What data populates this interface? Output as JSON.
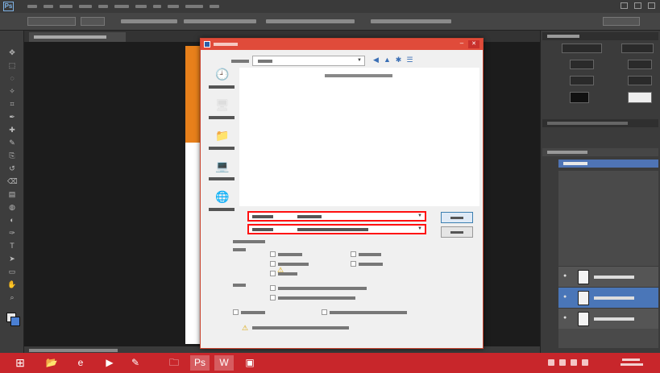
{
  "app": {
    "logo_text": "Ps"
  },
  "toolbar_icons": [
    "move-icon",
    "marquee-icon",
    "lasso-icon",
    "quick-select-icon",
    "crop-icon",
    "eyedropper-icon",
    "healing-brush-icon",
    "brush-icon",
    "clone-stamp-icon",
    "history-brush-icon",
    "eraser-icon",
    "gradient-icon",
    "blur-icon",
    "dodge-icon",
    "pen-icon",
    "type-icon",
    "path-select-icon",
    "shape-icon",
    "hand-icon",
    "zoom-icon"
  ],
  "save_dialog": {
    "highlight_color": "#ff1010",
    "title_bar_color": "#e04b3a",
    "close_glyph": "✕",
    "min_glyph": "–",
    "dropdown_glyph": "▼",
    "places": [
      {
        "icon": "recent-places-icon",
        "glyph": "🕘"
      },
      {
        "icon": "desktop-icon",
        "glyph": "🖥"
      },
      {
        "icon": "libraries-icon",
        "glyph": "📁"
      },
      {
        "icon": "computer-icon",
        "glyph": "💻"
      },
      {
        "icon": "network-icon",
        "glyph": "🌐"
      }
    ],
    "nav_glyphs": [
      "◀",
      "▲",
      "✱",
      "☰"
    ],
    "warning_glyph": "⚠"
  },
  "taskbar": {
    "color": "#c8262b",
    "start_glyph": "⊞",
    "apps": [
      {
        "icon": "explorer-icon",
        "glyph": "📂"
      },
      {
        "icon": "ie-icon",
        "glyph": "e"
      },
      {
        "icon": "media-icon",
        "glyph": "▶"
      },
      {
        "icon": "paint-icon",
        "glyph": "✎"
      },
      {
        "icon": "folder-icon",
        "glyph": "🗀"
      },
      {
        "icon": "photoshop-icon",
        "glyph": "Ps"
      },
      {
        "icon": "word-icon",
        "glyph": "W"
      },
      {
        "icon": "photos-icon",
        "glyph": "▣"
      }
    ]
  }
}
